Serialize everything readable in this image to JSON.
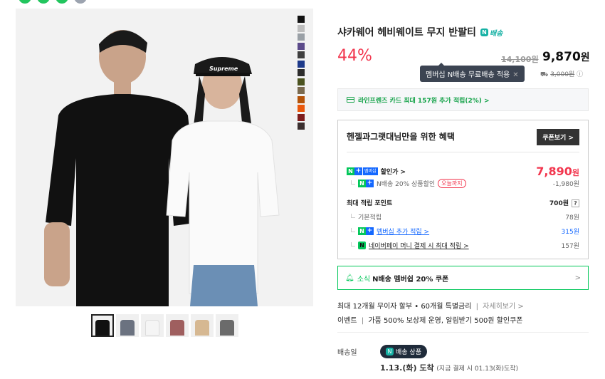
{
  "colors": {
    "accent_red": "#f2364e",
    "naver_green": "#03c75a",
    "tooltip_bg": "#3c4452",
    "delivery_teal": "#16b1a4"
  },
  "top_strip": [
    "#22c55e",
    "#22c55e",
    "#22c55e",
    "#9ca3af"
  ],
  "swatches": [
    "#111111",
    "#bdbdbd",
    "#9aa0a6",
    "#5b4a8a",
    "#3f3f3f",
    "#1e3a8a",
    "#2d2d2d",
    "#4b5320",
    "#7a6a4f",
    "#b45309",
    "#ea580c",
    "#7f1d1d",
    "#3b2f2f"
  ],
  "gallery": {
    "cap_text": "Supreme",
    "thumb_colors": [
      "#111111",
      "#6b7280",
      "#f5f5f5",
      "#9f5f5f",
      "#d6b892",
      "#6b6b6b"
    ]
  },
  "product": {
    "title": "샤카웨어 헤비웨이트 무지 반팔티",
    "delivery_badge": "배송",
    "discount": "44%",
    "original_price": "14,100원",
    "price_value": "9,870",
    "price_unit": "원",
    "tooltip": "멤버십 N배송 무료배송 적용",
    "shipping_fee": "3,000원"
  },
  "card_promo": "라인프렌즈 카드 최대 157원 추가 적립(2%) >",
  "benefit": {
    "title": "헨젤과그랫대님만을 위한 혜택",
    "coupon_button": "쿠폰보기 >",
    "discount_label": "할인가 >",
    "discount_price_value": "7,890",
    "discount_price_unit": "원",
    "nbaesong_label": "N배송 20% 상품할인",
    "today_tag": "오늘까지",
    "nbaesong_value": "-1,980원",
    "points_label": "최대 적립 포인트",
    "points_value": "700원",
    "help": "?",
    "basic_label": "기본적립",
    "basic_value": "78원",
    "membership_label": "멤버십 추가 적립 >",
    "membership_value": "315원",
    "npay_label": "네이버페이 머니 결제 시 최대 적립 >",
    "npay_value": "157원"
  },
  "notice": {
    "label": "소식",
    "text": "N배송 멤버쉽 20% 쿠폰",
    "chevron": ">"
  },
  "info": {
    "installment": "최대 12개월 무이자 할부 • 60개월 특별금리",
    "installment_link": "자세히보기 >",
    "event_label": "이벤트",
    "event_text": "가품 500% 보상제 운영, 알림받기 500원 할인쿠폰"
  },
  "delivery": {
    "label": "배송일",
    "badge": "배송 상품",
    "date": "1.13.(화) 도착",
    "date_detail": "(지금 결제 시 01.13(화)도착)"
  }
}
